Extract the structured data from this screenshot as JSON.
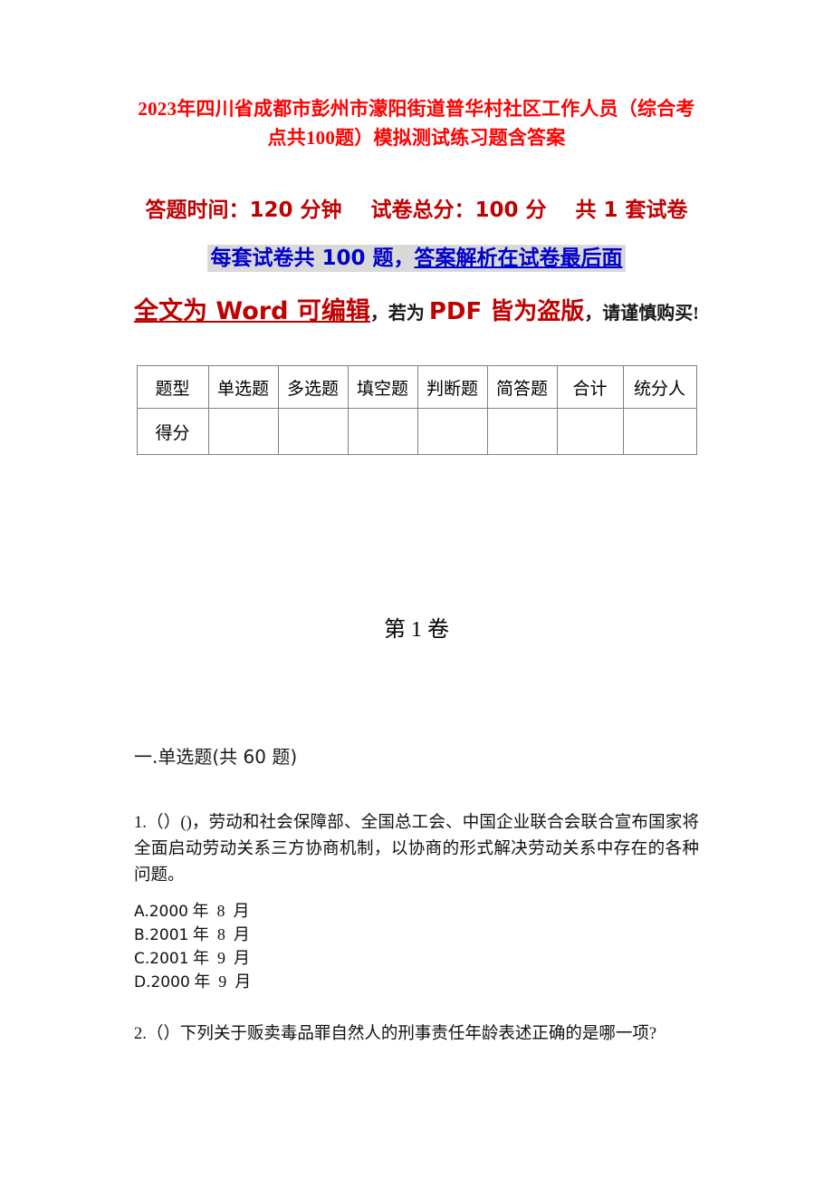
{
  "document": {
    "title": "2023年四川省成都市彭州市濛阳街道普华村社区工作人员（综合考点共100题）模拟测试练习题含答案",
    "info_line": "答题时间：120 分钟    试卷总分：100 分    共 1 套试卷",
    "highlight": {
      "part1": "每套试卷共 100 题，",
      "part2_underlined": "答案解析在试卷最后面"
    },
    "notice": {
      "word_part": "全文为 Word 可编辑",
      "comma1": "，若为 ",
      "pdf_part": "PDF 皆为盗版",
      "tail": "，请谨慎购买!"
    },
    "volume_heading": "第 1 卷",
    "section_heading": "一.单选题(共 60 题)"
  },
  "score_table": {
    "headers": [
      "题型",
      "单选题",
      "多选题",
      "填空题",
      "判断题",
      "简答题",
      "合计",
      "统分人"
    ],
    "rows": [
      {
        "label": "得分",
        "cells": [
          "",
          "",
          "",
          "",
          "",
          "",
          ""
        ]
      }
    ]
  },
  "questions": [
    {
      "number": "1",
      "text": "1.（）()，劳动和社会保障部、全国总工会、中国企业联合会联合宣布国家将全面启动劳动关系三方协商机制，以协商的形式解决劳动关系中存在的各种问题。",
      "options": [
        {
          "letter": "A",
          "latin": "A.2000",
          "cjk": " 年  8  月"
        },
        {
          "letter": "B",
          "latin": "B.2001",
          "cjk": " 年  8  月"
        },
        {
          "letter": "C",
          "latin": "C.2001",
          "cjk": " 年  9  月"
        },
        {
          "letter": "D",
          "latin": "D.2000",
          "cjk": " 年  9  月"
        }
      ]
    },
    {
      "number": "2",
      "text": "2.（）下列关于贩卖毒品罪自然人的刑事责任年龄表述正确的是哪一项?",
      "options": []
    }
  ],
  "colors": {
    "title_red": "#fe0000",
    "dark_red": "#c00000",
    "blue": "#0000cc",
    "highlight_gray": "#d9d9d9",
    "text_black": "#111111",
    "table_border": "#808080"
  }
}
